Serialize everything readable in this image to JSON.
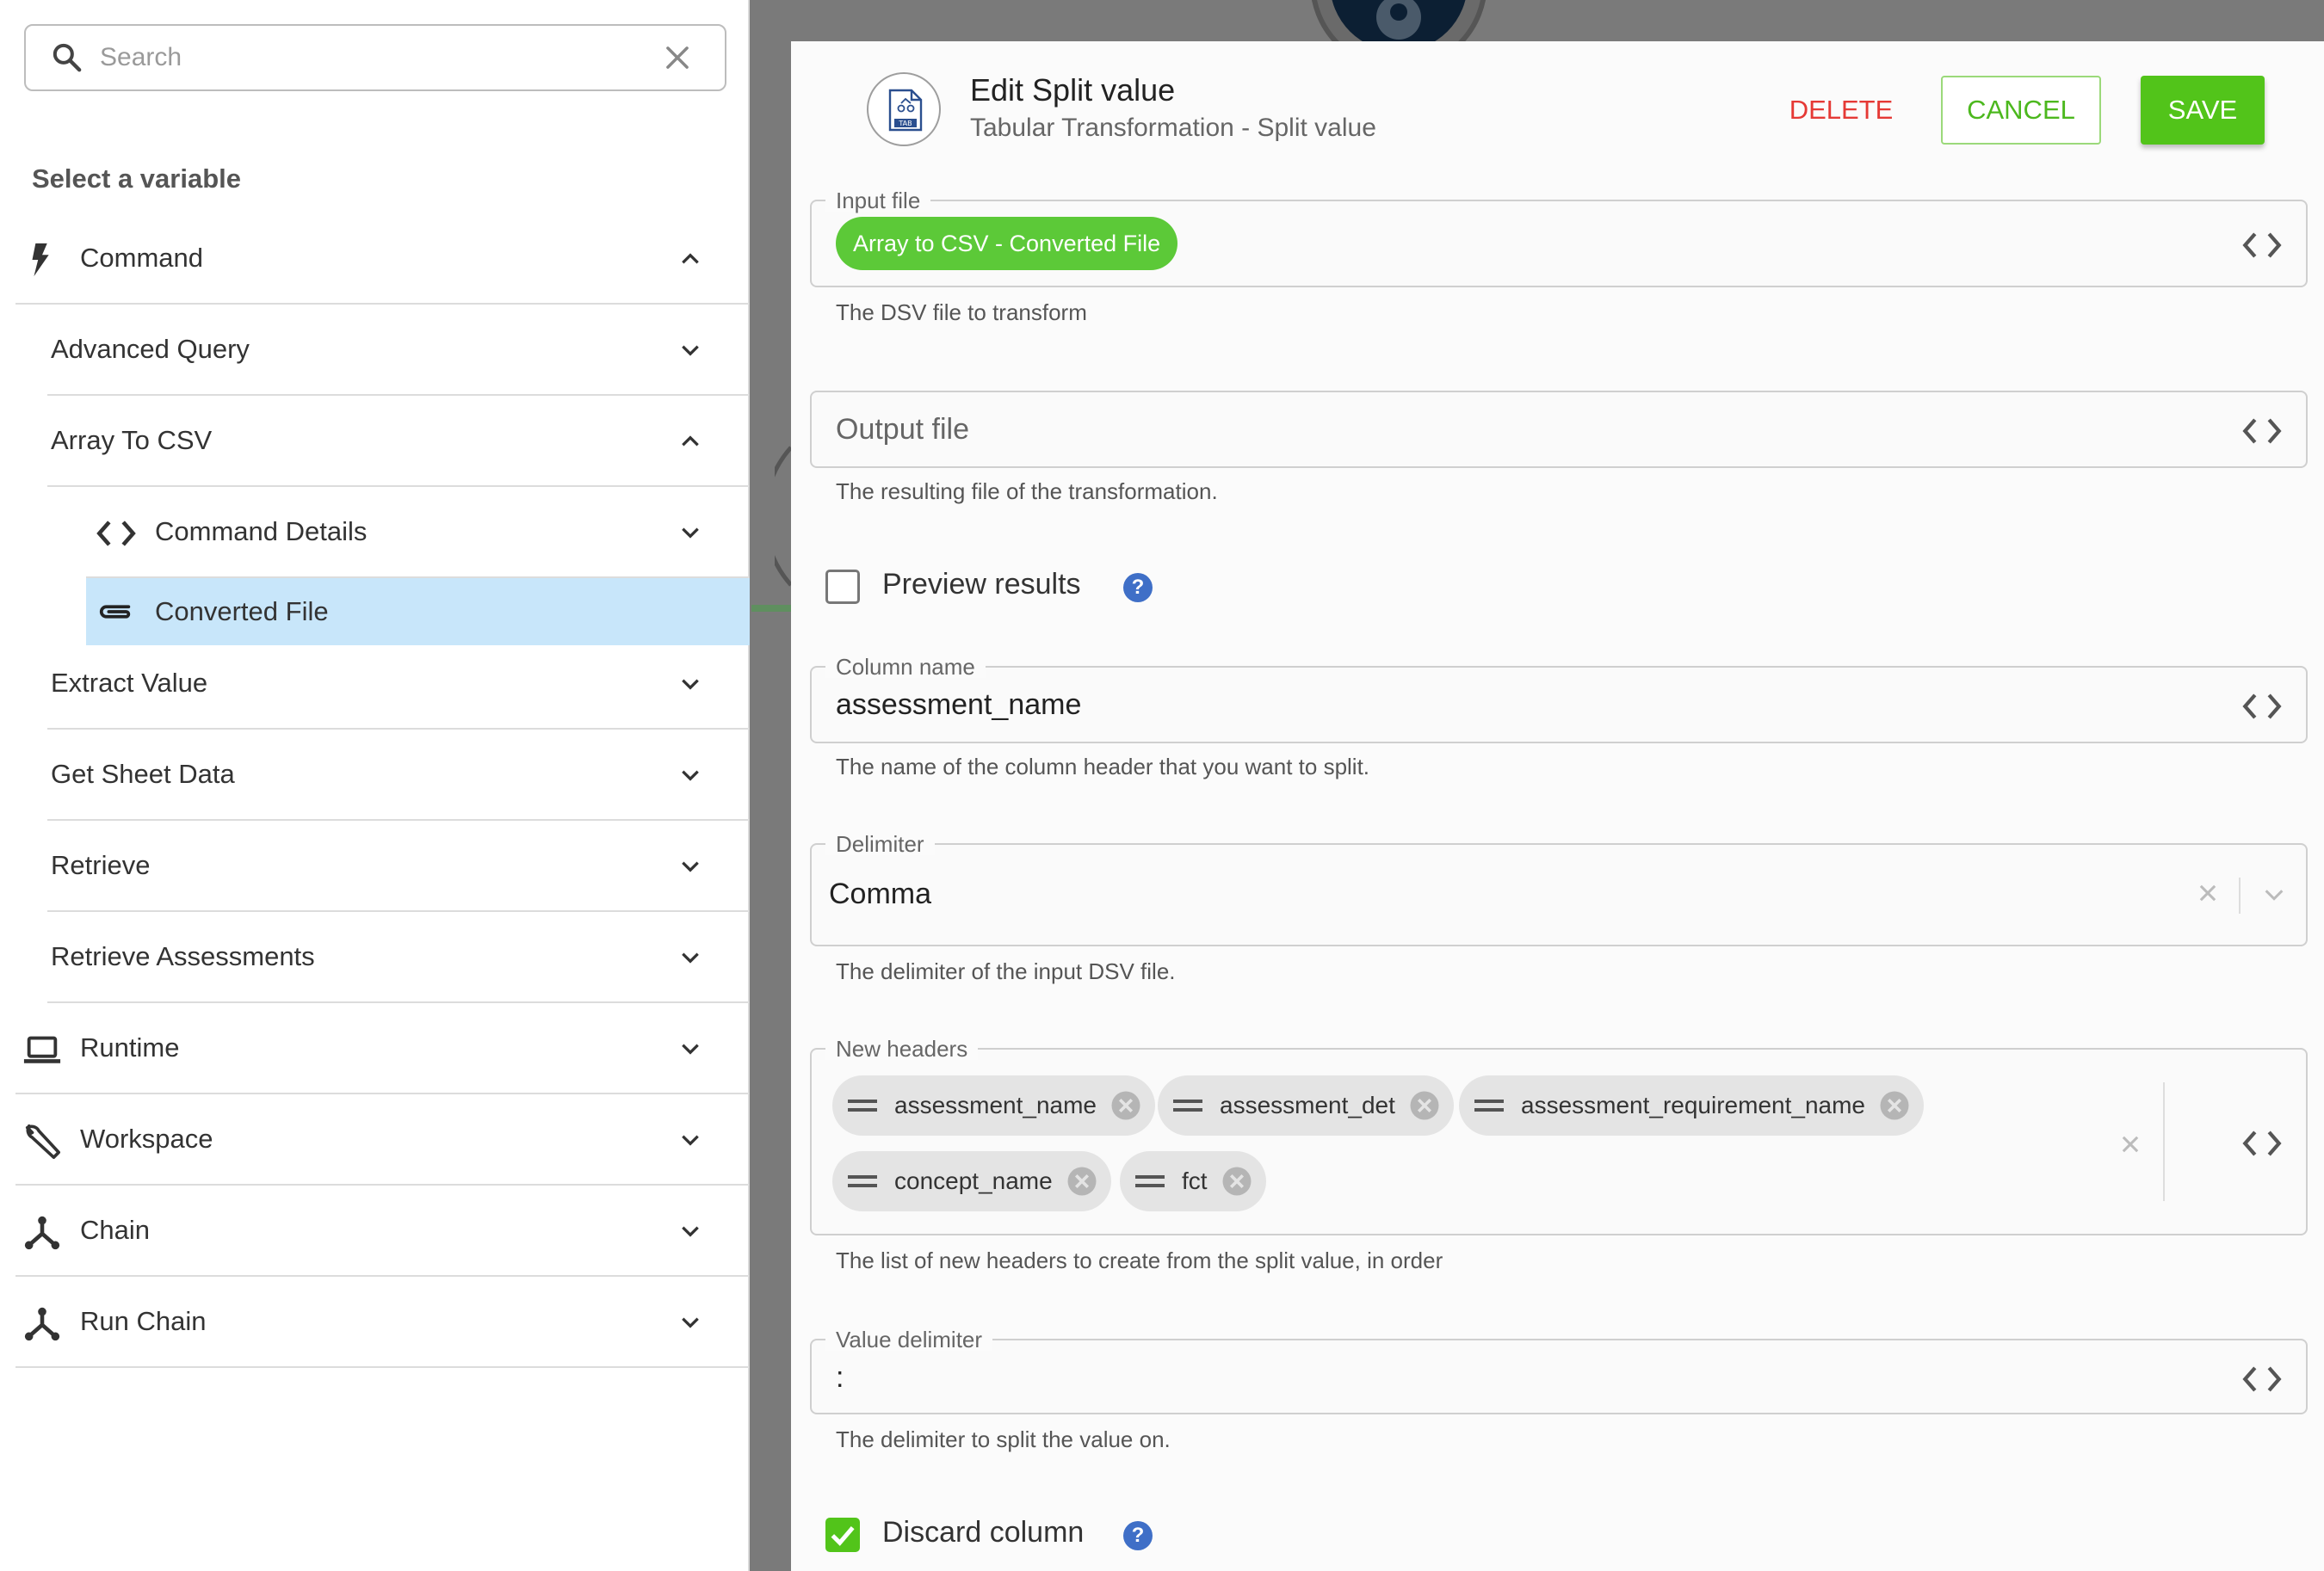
{
  "sidebar": {
    "search": {
      "placeholder": "Search",
      "value": ""
    },
    "title": "Select a variable",
    "items": [
      {
        "label": "Command",
        "icon": "lightning-icon",
        "expanded": true
      },
      {
        "label": "Advanced Query",
        "expanded": false
      },
      {
        "label": "Array To CSV",
        "expanded": true
      },
      {
        "label": "Command Details",
        "icon": "code-icon",
        "expanded": false
      },
      {
        "label": "Converted File",
        "icon": "paperclip-icon",
        "selected": true
      },
      {
        "label": "Extract Value",
        "expanded": false
      },
      {
        "label": "Get Sheet Data",
        "expanded": false
      },
      {
        "label": "Retrieve",
        "expanded": false
      },
      {
        "label": "Retrieve Assessments",
        "expanded": false
      },
      {
        "label": "Runtime",
        "icon": "laptop-icon",
        "expanded": false
      },
      {
        "label": "Workspace",
        "icon": "wrench-icon",
        "expanded": false
      },
      {
        "label": "Chain",
        "icon": "chain-icon",
        "expanded": false
      },
      {
        "label": "Run Chain",
        "icon": "chain-icon",
        "expanded": false
      }
    ]
  },
  "dialog": {
    "icon": "tab-file-icon",
    "title": "Edit Split value",
    "subtitle": "Tabular Transformation - Split value",
    "buttons": {
      "delete": "DELETE",
      "cancel": "CANCEL",
      "save": "SAVE"
    },
    "fields": {
      "input_file": {
        "label": "Input file",
        "chip": "Array to CSV - Converted File",
        "helper": "The DSV file to transform"
      },
      "output_file": {
        "placeholder": "Output file",
        "helper": "The resulting file of the transformation."
      },
      "preview": {
        "label": "Preview results",
        "checked": false
      },
      "column_name": {
        "label": "Column name",
        "value": "assessment_name",
        "helper": "The name of the column header that you want to split."
      },
      "delimiter": {
        "label": "Delimiter",
        "value": "Comma",
        "helper": "The delimiter of the input DSV file."
      },
      "new_headers": {
        "label": "New headers",
        "chips": [
          "assessment_name",
          "assessment_det",
          "assessment_requirement_name",
          "concept_name",
          "fct"
        ],
        "helper": "The list of new headers to create from the split value, in order"
      },
      "value_delimiter": {
        "label": "Value delimiter",
        "value": ":",
        "helper": "The delimiter to split the value on."
      },
      "discard": {
        "label": "Discard column",
        "checked": true
      }
    }
  },
  "colors": {
    "accent_green": "#52c41a",
    "chip_green": "#5cc938",
    "delete_red": "#e53935",
    "selected_blue": "#c8e6fa",
    "help_blue": "#3f6fc7"
  }
}
